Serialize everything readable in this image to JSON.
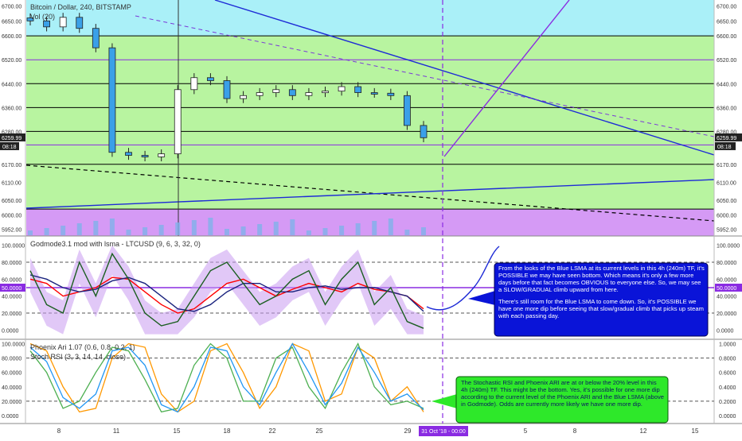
{
  "chart_data": [
    {
      "type": "candlestick",
      "title": "Bitcoin / Dollar, 240, BITSTAMP",
      "volume_label": "Vol (20)",
      "ylim": [
        5930,
        6720
      ],
      "y_ticks": [
        "6700.00",
        "6650.00",
        "6600.00",
        "6520.00",
        "6440.00",
        "6360.00",
        "6280.00",
        "6259.99",
        "6170.00",
        "6110.00",
        "6050.00",
        "6000.00",
        "5952.00"
      ],
      "last_price": "6259.99",
      "countdown": "08:18",
      "horizontal_levels": [
        6600,
        6520,
        6440,
        6360,
        6280,
        6235,
        6170,
        6020
      ],
      "candles": [
        {
          "x": "6",
          "close": 6650
        },
        {
          "x": "7",
          "close": 6630
        },
        {
          "x": "8",
          "close": 6662
        },
        {
          "x": "9",
          "close": 6625
        },
        {
          "x": "10",
          "close": 6560
        },
        {
          "x": "11",
          "close": 6210
        },
        {
          "x": "12",
          "close": 6200
        },
        {
          "x": "13",
          "close": 6195
        },
        {
          "x": "14",
          "close": 6205
        },
        {
          "x": "15",
          "close": 6420
        },
        {
          "x": "16",
          "close": 6460
        },
        {
          "x": "17",
          "close": 6450
        },
        {
          "x": "18",
          "close": 6390
        },
        {
          "x": "19",
          "close": 6400
        },
        {
          "x": "20",
          "close": 6410
        },
        {
          "x": "21",
          "close": 6420
        },
        {
          "x": "22",
          "close": 6400
        },
        {
          "x": "23",
          "close": 6410
        },
        {
          "x": "24",
          "close": 6415
        },
        {
          "x": "25",
          "close": 6430
        },
        {
          "x": "26",
          "close": 6410
        },
        {
          "x": "27",
          "close": 6408
        },
        {
          "x": "28",
          "close": 6400
        },
        {
          "x": "29",
          "close": 6300
        },
        {
          "x": "30",
          "close": 6259
        }
      ]
    },
    {
      "type": "line",
      "title": "Godmode3.1 mod with lsma - LTCUSD (9, 6, 3, 32, 0)",
      "ylim": [
        -10,
        110
      ],
      "y_ticks": [
        "100.0000",
        "80.0000",
        "60.0000",
        "40.0000",
        "20.0000",
        "0.0000"
      ],
      "reference_value": "50.0000",
      "series": [
        {
          "color": "#ff0000",
          "values": [
            60,
            55,
            40,
            45,
            50,
            62,
            60,
            45,
            30,
            20,
            25,
            40,
            55,
            60,
            50,
            40,
            48,
            55,
            50,
            45,
            55,
            48,
            45,
            40,
            25
          ]
        },
        {
          "color": "#1a237e",
          "values": [
            65,
            60,
            50,
            45,
            48,
            58,
            62,
            55,
            40,
            25,
            22,
            30,
            45,
            55,
            55,
            45,
            45,
            50,
            52,
            48,
            50,
            50,
            45,
            40,
            22
          ]
        },
        {
          "color": "#1b5e20",
          "values": [
            70,
            30,
            20,
            80,
            40,
            90,
            60,
            20,
            5,
            10,
            40,
            70,
            80,
            55,
            30,
            40,
            60,
            70,
            30,
            60,
            80,
            30,
            50,
            10,
            2
          ]
        }
      ]
    },
    {
      "type": "line",
      "title": "Phoenix Ari 1.07 (0.6, 0.8, 0.2, 1)",
      "subtitle": "Stoch RSI (3, 3, 14, 14, close)",
      "ylim": [
        -10,
        105
      ],
      "y_ticks_left": [
        "100.0000",
        "80.0000",
        "60.0000",
        "40.0000",
        "20.0000",
        "0.0000"
      ],
      "y_ticks_right": [
        "1.0000",
        "0.8000",
        "0.6000",
        "0.4000",
        "0.2000",
        "0.0000"
      ],
      "series": [
        {
          "color": "#ff9800",
          "values": [
            100,
            90,
            40,
            5,
            10,
            80,
            100,
            95,
            30,
            5,
            20,
            90,
            100,
            60,
            10,
            40,
            100,
            90,
            20,
            30,
            95,
            80,
            20,
            40,
            5
          ]
        },
        {
          "color": "#4caf50",
          "values": [
            90,
            60,
            10,
            20,
            60,
            95,
            90,
            50,
            5,
            10,
            70,
            100,
            80,
            20,
            20,
            80,
            95,
            40,
            10,
            60,
            100,
            40,
            15,
            20,
            10
          ]
        },
        {
          "color": "#2196f3",
          "values": [
            95,
            75,
            25,
            10,
            30,
            90,
            95,
            70,
            15,
            5,
            40,
            95,
            90,
            40,
            15,
            60,
            100,
            60,
            15,
            45,
            95,
            60,
            20,
            30,
            8
          ]
        }
      ]
    }
  ],
  "x_axis": {
    "labels": [
      "8",
      "11",
      "15",
      "18",
      "22",
      "25",
      "29",
      "5",
      "8",
      "12",
      "15"
    ],
    "highlight": "31 Oct '18 - 00:00"
  },
  "annotations": {
    "blue_box": {
      "p1": "From the looks of the Blue LSMA at its current levels in this 4h (240m) TF, it's POSSIBLE we may have seen bottom.  Which means it's only a few more days before that fact becomes OBVIOUS to everyone else.  So, we may see a SLOW/GRADUAL climb upward from here.",
      "p2": "There's still room for the Blue LSMA to come down.  So, it's POSSIBLE we have one more dip before seeing that slow/gradual climb that picks up steam with each passing day."
    },
    "green_box": {
      "p1": "The Stochastic RSI and Phoenix ARI are at or below the 20% level in this 4h (240m) TF.  This might be the bottom.  Yes, it's possible for one more dip according to the current level of the Phoenix ARI and the Blue LSMA (above in Godmode).  Odds are currently more likely we have one more dip."
    }
  },
  "colors": {
    "cyan_zone": "#aaf0f8",
    "green_zone": "#b8f4a0",
    "purple_zone": "#d59af5",
    "blue_box": "#0a14d8",
    "green_box": "#2ee82a",
    "purple_line": "#8a2be2"
  }
}
